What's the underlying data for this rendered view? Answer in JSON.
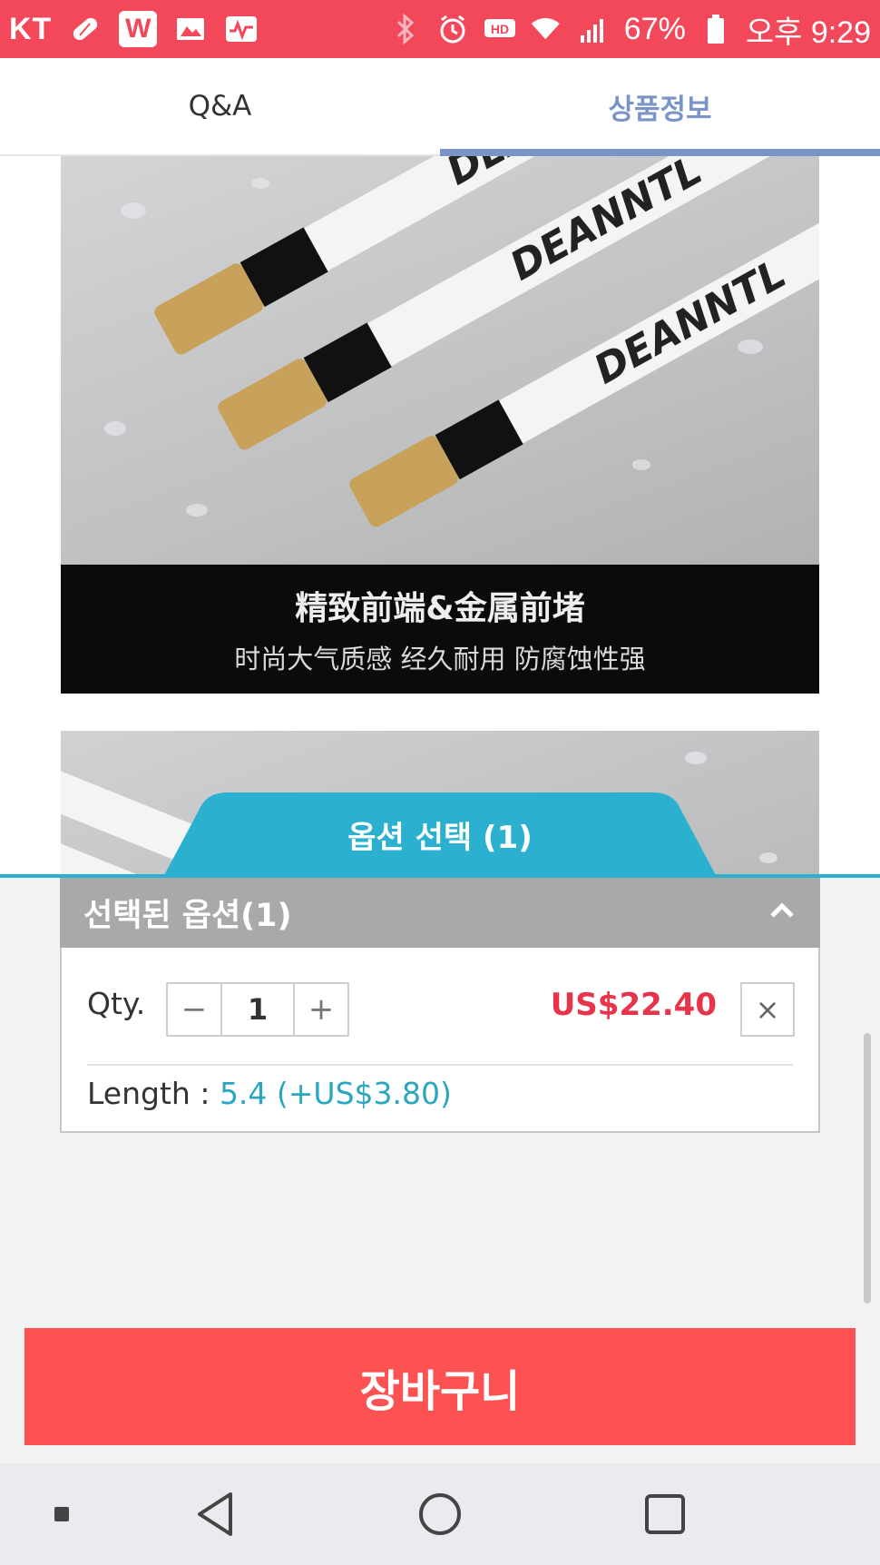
{
  "status_bar": {
    "carrier": "KT",
    "w_label": "W",
    "battery": "67%",
    "time": "오후 9:29",
    "icons": [
      "pill-icon",
      "w-app-icon",
      "gallery-icon",
      "activity-icon",
      "bluetooth-icon",
      "alarm-icon",
      "hd-icon",
      "wifi-icon",
      "signal-icon",
      "battery-icon"
    ]
  },
  "tabs": [
    {
      "label": "Q&A",
      "active": false
    },
    {
      "label": "상품정보",
      "active": true
    }
  ],
  "product_image": {
    "caption_title": "精致前端&金属前堵",
    "caption_sub": "时尚大气质感 经久耐用 防腐蚀性强"
  },
  "option_sheet": {
    "tab_label": "옵션 선택 (1)",
    "selected_header": "선택된 옵션(1)",
    "qty_label": "Qty.",
    "qty_value": "1",
    "decrement": "−",
    "increment": "+",
    "price": "US$22.40",
    "remove": "×",
    "length_label": "Length :",
    "length_value": "5.4 (+US$3.80)"
  },
  "cart_button": "장바구니",
  "colors": {
    "status_bar": "#f2485a",
    "active_tab": "#7a94c7",
    "sheet_accent": "#2bb1cf",
    "price": "#e8344a",
    "cart": "#fc5352"
  }
}
